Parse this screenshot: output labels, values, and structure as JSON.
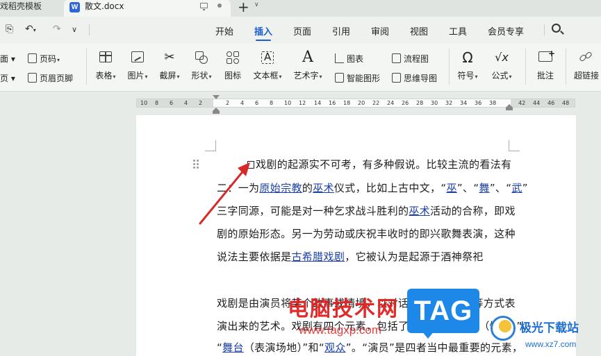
{
  "tabs": {
    "inactive_label": "戏稻壳模板",
    "active_title": "散文.docx",
    "app_logo_letter": "W"
  },
  "menu": {
    "items": [
      "开始",
      "插入",
      "页面",
      "引用",
      "审阅",
      "视图",
      "工具",
      "会员专享"
    ],
    "active": "插入"
  },
  "ribbon": {
    "left_col1": [
      "面 ▾",
      "页 ▾"
    ],
    "page_number": "页码",
    "header_footer": "页眉页脚",
    "big": [
      {
        "label": "表格",
        "icon": "table-icon"
      },
      {
        "label": "图片",
        "icon": "picture-icon"
      },
      {
        "label": "截屏",
        "icon": "screenshot-icon"
      },
      {
        "label": "形状",
        "icon": "shape-icon"
      },
      {
        "label": "图标",
        "icon": "icons-icon"
      },
      {
        "label": "文本框",
        "icon": "textbox-icon"
      },
      {
        "label": "艺术字",
        "icon": "wordart-icon"
      }
    ],
    "chart": "图表",
    "smart_graphic": "智能图形",
    "flowchart": "流程图",
    "mindmap": "思维导图",
    "symbol": "符号",
    "formula": "公式",
    "comment": "批注",
    "hyperlink": "超链接"
  },
  "ruler": {
    "ticks": [
      "10",
      "8",
      "6",
      "4",
      "2",
      "2",
      "4",
      "6",
      "8",
      "10",
      "12",
      "14",
      "16",
      "18",
      "20",
      "22",
      "24",
      "26",
      "28",
      "30",
      "32",
      "34",
      "36",
      "38",
      "42",
      "44",
      "46",
      "48"
    ]
  },
  "document": {
    "lines": [
      {
        "parts": [
          {
            "t": "戏剧的起源实不可考，有多种假说。比较主流的看法有"
          }
        ]
      },
      {
        "parts": [
          {
            "t": "二：一为"
          },
          {
            "t": "原始宗教",
            "link": true
          },
          {
            "t": "的"
          },
          {
            "t": "巫术",
            "link": true
          },
          {
            "t": "仪式，比如上古中文，“"
          },
          {
            "t": "巫",
            "link": true
          },
          {
            "t": "”、“"
          },
          {
            "t": "舞",
            "link": true
          },
          {
            "t": "”、“"
          },
          {
            "t": "武",
            "link": true
          },
          {
            "t": "”"
          }
        ]
      },
      {
        "parts": [
          {
            "t": "三字同源，可能是对一种乞求战斗胜利的"
          },
          {
            "t": "巫术",
            "link": true
          },
          {
            "t": "活动的合称，即戏"
          }
        ]
      },
      {
        "parts": [
          {
            "t": "剧的原始形态。另一为劳动或庆祝丰收时的即兴歌舞表演，这种"
          }
        ]
      },
      {
        "parts": [
          {
            "t": "说法主要依据是"
          },
          {
            "t": "古希腊戏剧",
            "link": true
          },
          {
            "t": "，它被认为是起源于酒神祭祀"
          }
        ]
      },
      {
        "parts": [
          {
            "t": "戏剧是由演员将某个故事或情境，以对话、歌唱或动作等方式表"
          }
        ]
      },
      {
        "parts": [
          {
            "t": "演出来的艺术。戏剧有四个元素，包括了“"
          },
          {
            "t": "演员",
            "link": true
          },
          {
            "t": "”、“故事（情境）”、"
          }
        ]
      },
      {
        "parts": [
          {
            "t": "“"
          },
          {
            "t": "舞台",
            "link": true
          },
          {
            "t": "（表演场地）”和“"
          },
          {
            "t": "观众",
            "link": true
          },
          {
            "t": "”。“演员”是四者当中最重要的元素，"
          }
        ]
      }
    ]
  },
  "watermark": {
    "cn": "电脑技术网",
    "url": "www.tagxp.com",
    "tag": "TAG",
    "site_cn": "极光下载站",
    "site_url": "www.xz7.com"
  },
  "colors": {
    "accent": "#1a5fd0",
    "link": "#1a3fa8",
    "arrow": "#d62a2a"
  }
}
